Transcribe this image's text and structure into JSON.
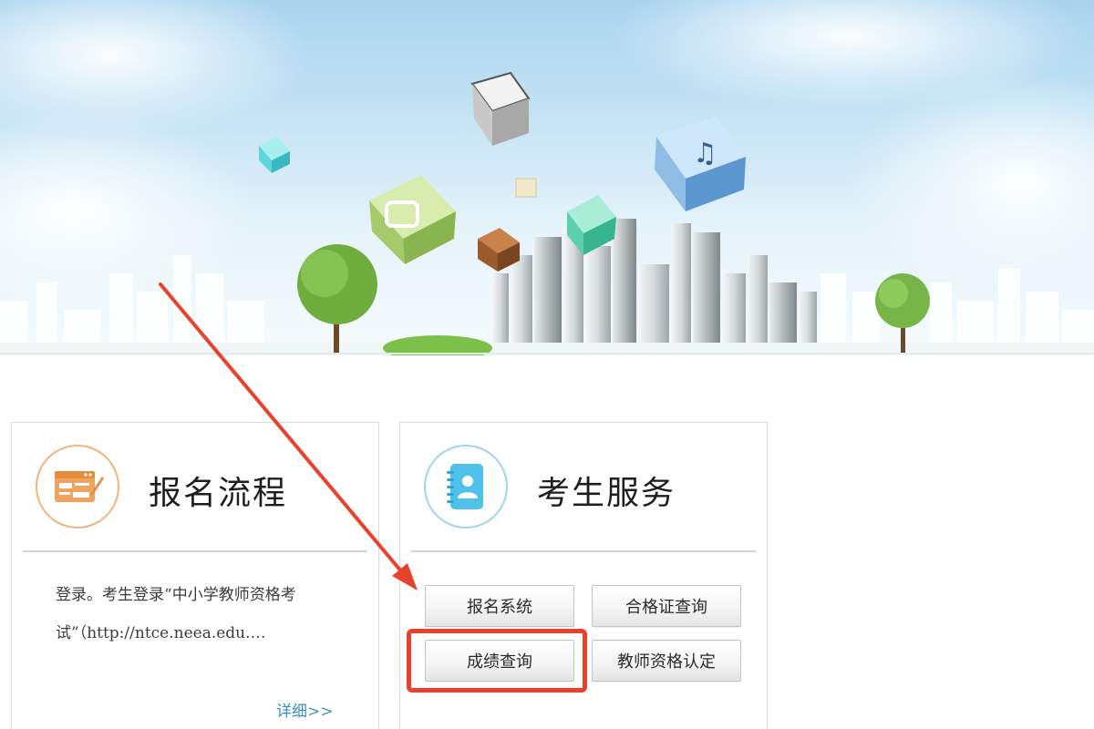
{
  "registration": {
    "title": "报名流程",
    "text": "登录。考生登录“中小学教师资格考试”（http://ntce.neea.edu.…",
    "more_link": "详细>>"
  },
  "services": {
    "title": "考生服务",
    "buttons": [
      {
        "label": "报名系统"
      },
      {
        "label": "合格证查询"
      },
      {
        "label": "成绩查询"
      },
      {
        "label": "教师资格认定"
      }
    ]
  },
  "annotation": {
    "color": "#e8412c",
    "highlighted_button": "成绩查询"
  },
  "theme": {
    "registration_accent": "#f0a35e",
    "services_accent": "#4fc1ea",
    "link_color": "#3b8fc7"
  }
}
